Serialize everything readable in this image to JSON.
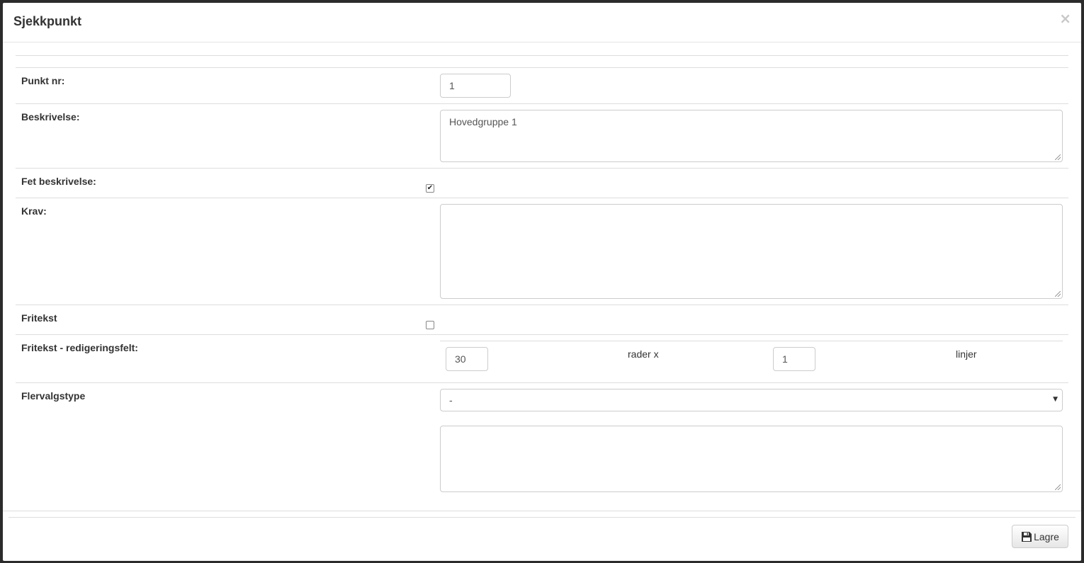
{
  "modal": {
    "title": "Sjekkpunkt",
    "close_label": "×"
  },
  "form": {
    "punkt_nr": {
      "label": "Punkt nr:",
      "value": "1"
    },
    "beskrivelse": {
      "label": "Beskrivelse:",
      "value": "Hovedgruppe 1"
    },
    "fet_beskrivelse": {
      "label": "Fet beskrivelse:",
      "checked": true,
      "check_glyph": "✔"
    },
    "krav": {
      "label": "Krav:",
      "value": ""
    },
    "fritekst": {
      "label": "Fritekst",
      "checked": false
    },
    "fritekst_felt": {
      "label": "Fritekst - redigeringsfelt:",
      "rows_value": "30",
      "rows_suffix": "rader x",
      "lines_value": "1",
      "lines_suffix": "linjer"
    },
    "flervalgstype": {
      "label": "Flervalgstype",
      "selected": "-",
      "extra_value": ""
    }
  },
  "footer": {
    "save_label": "Lagre",
    "save_icon": "floppy-disk-icon"
  }
}
